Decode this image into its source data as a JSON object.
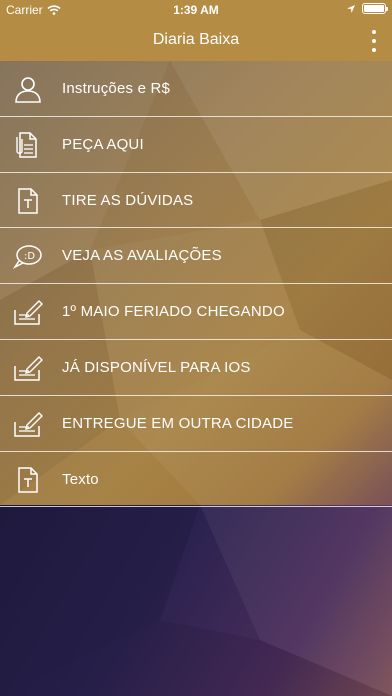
{
  "status": {
    "carrier": "Carrier",
    "time": "1:39 AM"
  },
  "navbar": {
    "title": "Diaria Baixa"
  },
  "menu_items": [
    {
      "label": "Instruções e R$",
      "icon": "user-icon"
    },
    {
      "label": "PEÇA AQUI",
      "icon": "documents-icon"
    },
    {
      "label": "TIRE AS DÚVIDAS",
      "icon": "text-document-icon"
    },
    {
      "label": "VEJA AS AVALIAÇÕES",
      "icon": "chat-smile-icon"
    },
    {
      "label": "1º MAIO FERIADO CHEGANDO",
      "icon": "write-note-icon"
    },
    {
      "label": "JÁ DISPONÍVEL PARA IOS",
      "icon": "write-note-icon"
    },
    {
      "label": "ENTREGUE EM OUTRA CIDADE",
      "icon": "write-note-icon"
    },
    {
      "label": "Texto",
      "icon": "text-document-icon"
    }
  ],
  "colors": {
    "bar": "#b58c44",
    "text": "#ffffff"
  }
}
